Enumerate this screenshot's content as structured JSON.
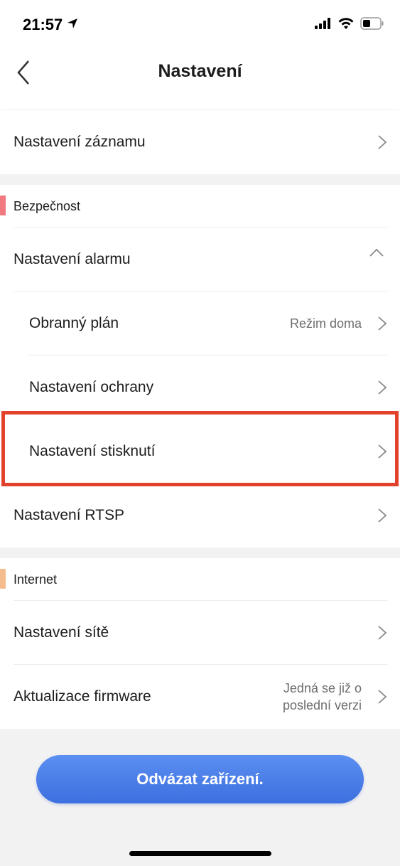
{
  "status_bar": {
    "time": "21:57"
  },
  "nav": {
    "title": "Nastavení"
  },
  "rows": {
    "record_settings": "Nastavení záznamu",
    "alarm_settings": "Nastavení alarmu",
    "defense_plan": {
      "label": "Obranný plán",
      "value": "Režim doma"
    },
    "protection_settings": "Nastavení ochrany",
    "press_settings": "Nastavení stisknutí",
    "rtsp_settings": "Nastavení RTSP",
    "network_settings": "Nastavení sítě",
    "firmware_update": {
      "label": "Aktualizace firmware",
      "value_line1": "Jedná se již o",
      "value_line2": "poslední verzi"
    }
  },
  "sections": {
    "security": {
      "label": "Bezpečnost",
      "color": "#f07a80"
    },
    "internet": {
      "label": "Internet",
      "color": "#f5bd8e"
    }
  },
  "unbind_button": {
    "label": "Odvázat zařízení."
  },
  "colors": {
    "accent": "#4a7ee8",
    "highlight": "#e2412c"
  }
}
